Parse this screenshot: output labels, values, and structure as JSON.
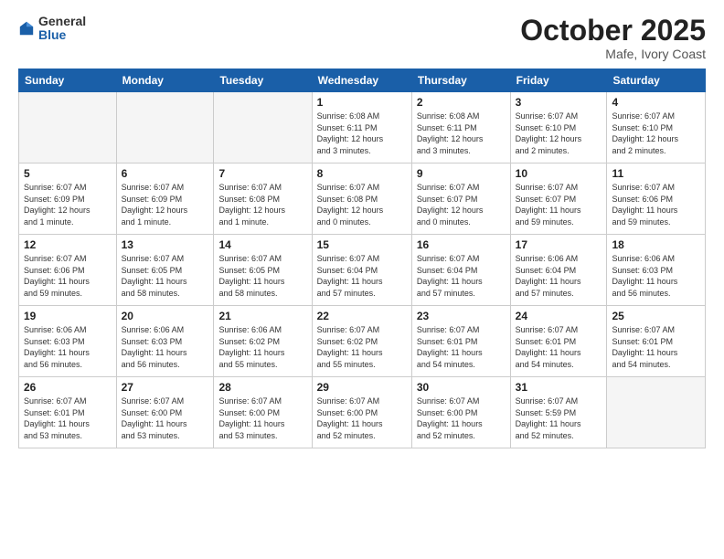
{
  "logo": {
    "general": "General",
    "blue": "Blue"
  },
  "header": {
    "month": "October 2025",
    "location": "Mafe, Ivory Coast"
  },
  "weekdays": [
    "Sunday",
    "Monday",
    "Tuesday",
    "Wednesday",
    "Thursday",
    "Friday",
    "Saturday"
  ],
  "weeks": [
    [
      {
        "day": "",
        "info": ""
      },
      {
        "day": "",
        "info": ""
      },
      {
        "day": "",
        "info": ""
      },
      {
        "day": "1",
        "info": "Sunrise: 6:08 AM\nSunset: 6:11 PM\nDaylight: 12 hours\nand 3 minutes."
      },
      {
        "day": "2",
        "info": "Sunrise: 6:08 AM\nSunset: 6:11 PM\nDaylight: 12 hours\nand 3 minutes."
      },
      {
        "day": "3",
        "info": "Sunrise: 6:07 AM\nSunset: 6:10 PM\nDaylight: 12 hours\nand 2 minutes."
      },
      {
        "day": "4",
        "info": "Sunrise: 6:07 AM\nSunset: 6:10 PM\nDaylight: 12 hours\nand 2 minutes."
      }
    ],
    [
      {
        "day": "5",
        "info": "Sunrise: 6:07 AM\nSunset: 6:09 PM\nDaylight: 12 hours\nand 1 minute."
      },
      {
        "day": "6",
        "info": "Sunrise: 6:07 AM\nSunset: 6:09 PM\nDaylight: 12 hours\nand 1 minute."
      },
      {
        "day": "7",
        "info": "Sunrise: 6:07 AM\nSunset: 6:08 PM\nDaylight: 12 hours\nand 1 minute."
      },
      {
        "day": "8",
        "info": "Sunrise: 6:07 AM\nSunset: 6:08 PM\nDaylight: 12 hours\nand 0 minutes."
      },
      {
        "day": "9",
        "info": "Sunrise: 6:07 AM\nSunset: 6:07 PM\nDaylight: 12 hours\nand 0 minutes."
      },
      {
        "day": "10",
        "info": "Sunrise: 6:07 AM\nSunset: 6:07 PM\nDaylight: 11 hours\nand 59 minutes."
      },
      {
        "day": "11",
        "info": "Sunrise: 6:07 AM\nSunset: 6:06 PM\nDaylight: 11 hours\nand 59 minutes."
      }
    ],
    [
      {
        "day": "12",
        "info": "Sunrise: 6:07 AM\nSunset: 6:06 PM\nDaylight: 11 hours\nand 59 minutes."
      },
      {
        "day": "13",
        "info": "Sunrise: 6:07 AM\nSunset: 6:05 PM\nDaylight: 11 hours\nand 58 minutes."
      },
      {
        "day": "14",
        "info": "Sunrise: 6:07 AM\nSunset: 6:05 PM\nDaylight: 11 hours\nand 58 minutes."
      },
      {
        "day": "15",
        "info": "Sunrise: 6:07 AM\nSunset: 6:04 PM\nDaylight: 11 hours\nand 57 minutes."
      },
      {
        "day": "16",
        "info": "Sunrise: 6:07 AM\nSunset: 6:04 PM\nDaylight: 11 hours\nand 57 minutes."
      },
      {
        "day": "17",
        "info": "Sunrise: 6:06 AM\nSunset: 6:04 PM\nDaylight: 11 hours\nand 57 minutes."
      },
      {
        "day": "18",
        "info": "Sunrise: 6:06 AM\nSunset: 6:03 PM\nDaylight: 11 hours\nand 56 minutes."
      }
    ],
    [
      {
        "day": "19",
        "info": "Sunrise: 6:06 AM\nSunset: 6:03 PM\nDaylight: 11 hours\nand 56 minutes."
      },
      {
        "day": "20",
        "info": "Sunrise: 6:06 AM\nSunset: 6:03 PM\nDaylight: 11 hours\nand 56 minutes."
      },
      {
        "day": "21",
        "info": "Sunrise: 6:06 AM\nSunset: 6:02 PM\nDaylight: 11 hours\nand 55 minutes."
      },
      {
        "day": "22",
        "info": "Sunrise: 6:07 AM\nSunset: 6:02 PM\nDaylight: 11 hours\nand 55 minutes."
      },
      {
        "day": "23",
        "info": "Sunrise: 6:07 AM\nSunset: 6:01 PM\nDaylight: 11 hours\nand 54 minutes."
      },
      {
        "day": "24",
        "info": "Sunrise: 6:07 AM\nSunset: 6:01 PM\nDaylight: 11 hours\nand 54 minutes."
      },
      {
        "day": "25",
        "info": "Sunrise: 6:07 AM\nSunset: 6:01 PM\nDaylight: 11 hours\nand 54 minutes."
      }
    ],
    [
      {
        "day": "26",
        "info": "Sunrise: 6:07 AM\nSunset: 6:01 PM\nDaylight: 11 hours\nand 53 minutes."
      },
      {
        "day": "27",
        "info": "Sunrise: 6:07 AM\nSunset: 6:00 PM\nDaylight: 11 hours\nand 53 minutes."
      },
      {
        "day": "28",
        "info": "Sunrise: 6:07 AM\nSunset: 6:00 PM\nDaylight: 11 hours\nand 53 minutes."
      },
      {
        "day": "29",
        "info": "Sunrise: 6:07 AM\nSunset: 6:00 PM\nDaylight: 11 hours\nand 52 minutes."
      },
      {
        "day": "30",
        "info": "Sunrise: 6:07 AM\nSunset: 6:00 PM\nDaylight: 11 hours\nand 52 minutes."
      },
      {
        "day": "31",
        "info": "Sunrise: 6:07 AM\nSunset: 5:59 PM\nDaylight: 11 hours\nand 52 minutes."
      },
      {
        "day": "",
        "info": ""
      }
    ]
  ]
}
